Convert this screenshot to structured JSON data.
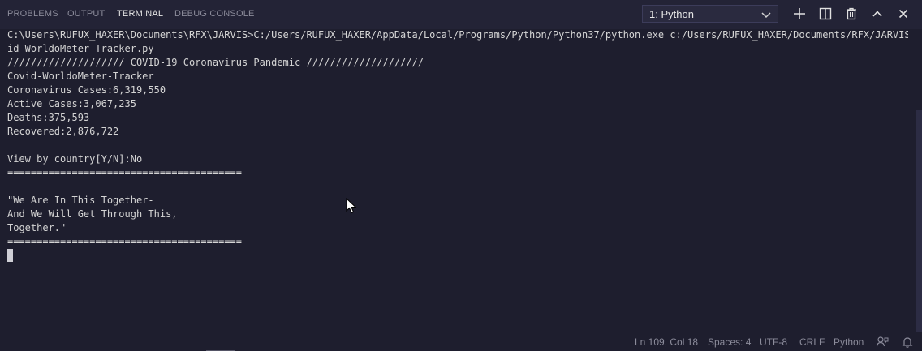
{
  "panel": {
    "tabs": [
      {
        "label": "PROBLEMS"
      },
      {
        "label": "OUTPUT"
      },
      {
        "label": "TERMINAL"
      },
      {
        "label": "DEBUG CONSOLE"
      }
    ],
    "active_tab": "TERMINAL",
    "terminal_select": {
      "value": "1: Python",
      "icon": "chevron-down-icon"
    },
    "toolbar_icons": [
      "plus-icon",
      "split-terminal-icon",
      "trash-icon",
      "chevron-up-icon",
      "close-icon"
    ]
  },
  "terminal": {
    "lines": [
      "C:\\Users\\RUFUX_HAXER\\Documents\\RFX\\JARVIS>C:/Users/RUFUX_HAXER/AppData/Local/Programs/Python/Python37/python.exe c:/Users/RUFUX_HAXER/Documents/RFX/JARVIS/Cov",
      "id-WorldoMeter-Tracker.py",
      "//////////////////// COVID-19 Coronavirus Pandemic ////////////////////",
      "Covid-WorldoMeter-Tracker",
      "Coronavirus Cases:6,319,550",
      "Active Cases:3,067,235",
      "Deaths:375,593",
      "Recovered:2,876,722",
      "",
      "View by country[Y/N]:No",
      "========================================",
      "",
      "\"We Are In This Together-",
      "And We Will Get Through This,",
      "Together.\"",
      "========================================"
    ]
  },
  "status_bar": {
    "position": "Ln 109, Col 18",
    "spaces": "Spaces: 4",
    "encoding": "UTF-8",
    "eol": "CRLF",
    "language": "Python",
    "icons": [
      "feedback-icon",
      "bell-icon"
    ]
  },
  "colors": {
    "background": "#1e1e2e",
    "header_background": "#232336",
    "text": "#d4d4d4",
    "muted_text": "#8b8b9a"
  }
}
